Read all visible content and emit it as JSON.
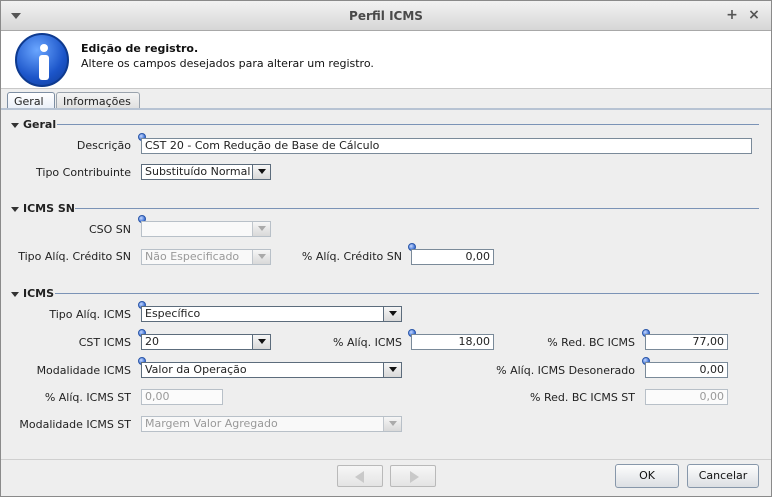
{
  "window": {
    "title": "Perfil ICMS"
  },
  "header": {
    "title": "Edição de registro.",
    "subtitle": "Altere os campos desejados para alterar um registro."
  },
  "tabs": [
    {
      "label": "Geral",
      "active": true
    },
    {
      "label": "Informações",
      "active": false
    }
  ],
  "sections": {
    "geral": {
      "title": "Geral",
      "descricao": {
        "label": "Descrição",
        "value": "CST 20 - Com Redução de Base de Cálculo"
      },
      "tipo_contribuinte": {
        "label": "Tipo Contribuinte",
        "value": "Substituído Normal"
      }
    },
    "icms_sn": {
      "title": "ICMS SN",
      "cso_sn": {
        "label": "CSO SN",
        "value": ""
      },
      "tipo_aliq_credito": {
        "label": "Tipo Alíq. Crédito SN",
        "value": "Não Especificado"
      },
      "aliq_credito": {
        "label": "% Alíq. Crédito SN",
        "value": "0,00"
      }
    },
    "icms": {
      "title": "ICMS",
      "tipo_aliq": {
        "label": "Tipo Alíq. ICMS",
        "value": "Específico"
      },
      "cst": {
        "label": "CST ICMS",
        "value": "20"
      },
      "aliq": {
        "label": "% Alíq. ICMS",
        "value": "18,00"
      },
      "red_bc": {
        "label": "% Red. BC ICMS",
        "value": "77,00"
      },
      "modalidade": {
        "label": "Modalidade ICMS",
        "value": "Valor da Operação"
      },
      "aliq_desonerado": {
        "label": "% Alíq. ICMS Desonerado",
        "value": "0,00"
      },
      "aliq_st": {
        "label": "% Alíq. ICMS ST",
        "value": "0,00"
      },
      "red_bc_st": {
        "label": "% Red. BC ICMS ST",
        "value": "0,00"
      },
      "modalidade_st": {
        "label": "Modalidade ICMS ST",
        "value": "Margem Valor Agregado"
      }
    }
  },
  "footer": {
    "ok_label": "OK",
    "cancel_label": "Cancelar"
  },
  "colors": {
    "section_line": "#7b93b6",
    "required_marker": "#3b6fd4"
  }
}
